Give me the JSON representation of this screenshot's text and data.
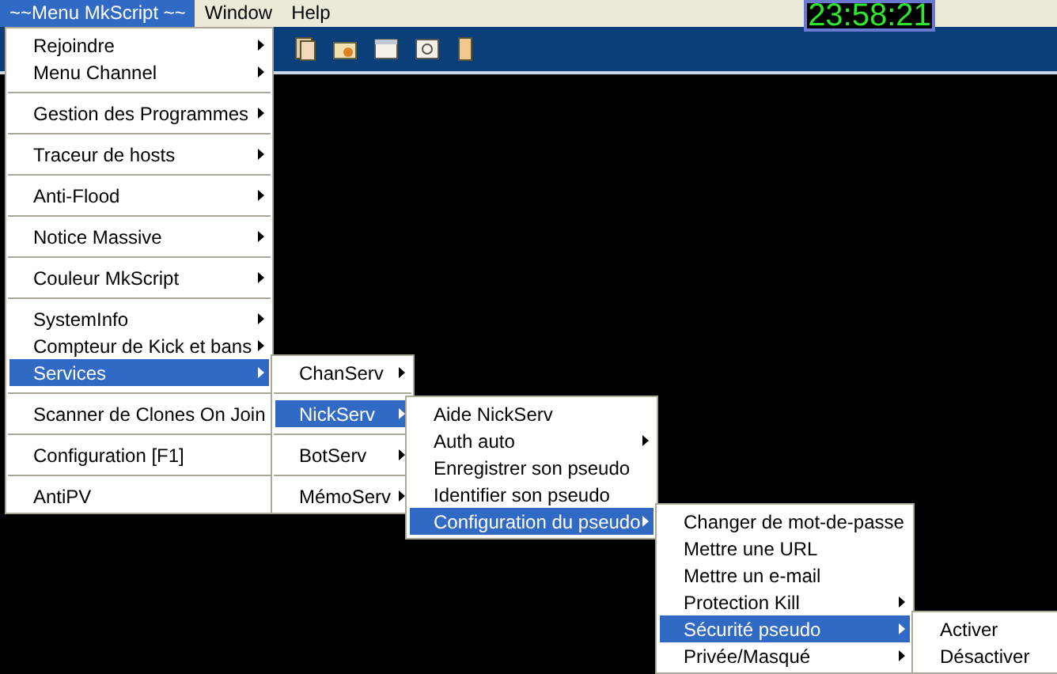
{
  "menubar": [
    {
      "label": "~~Menu MkScript ~~",
      "selected": true
    },
    {
      "label": "Window",
      "selected": false
    },
    {
      "label": "Help",
      "selected": false
    }
  ],
  "clock": "23:58:21",
  "menus": [
    {
      "items": [
        {
          "kind": "item",
          "label": "Rejoindre",
          "submenu": true,
          "selected": false
        },
        {
          "kind": "item",
          "label": "Menu Channel",
          "submenu": true,
          "selected": false
        },
        {
          "kind": "separator"
        },
        {
          "kind": "item",
          "label": "Gestion des Programmes",
          "submenu": true,
          "selected": false
        },
        {
          "kind": "separator"
        },
        {
          "kind": "item",
          "label": "Traceur de hosts",
          "submenu": true,
          "selected": false
        },
        {
          "kind": "separator"
        },
        {
          "kind": "item",
          "label": "Anti-Flood",
          "submenu": true,
          "selected": false
        },
        {
          "kind": "separator"
        },
        {
          "kind": "item",
          "label": "Notice Massive",
          "submenu": true,
          "selected": false
        },
        {
          "kind": "separator"
        },
        {
          "kind": "item",
          "label": "Couleur MkScript",
          "submenu": true,
          "selected": false
        },
        {
          "kind": "separator"
        },
        {
          "kind": "item",
          "label": "SystemInfo",
          "submenu": true,
          "selected": false
        },
        {
          "kind": "item",
          "label": "Compteur de Kick et bans",
          "submenu": true,
          "selected": false
        },
        {
          "kind": "item",
          "label": "Services",
          "submenu": true,
          "selected": true
        },
        {
          "kind": "separator"
        },
        {
          "kind": "item",
          "label": "Scanner de Clones On Join",
          "submenu": false,
          "selected": false
        },
        {
          "kind": "separator"
        },
        {
          "kind": "item",
          "label": "Configuration [F1]",
          "submenu": false,
          "selected": false
        },
        {
          "kind": "separator"
        },
        {
          "kind": "item",
          "label": "AntiPV",
          "submenu": false,
          "selected": false
        }
      ]
    },
    {
      "items": [
        {
          "kind": "item",
          "label": "ChanServ",
          "submenu": true,
          "selected": false
        },
        {
          "kind": "separator"
        },
        {
          "kind": "item",
          "label": "NickServ",
          "submenu": true,
          "selected": true
        },
        {
          "kind": "separator"
        },
        {
          "kind": "item",
          "label": "BotServ",
          "submenu": true,
          "selected": false
        },
        {
          "kind": "separator"
        },
        {
          "kind": "item",
          "label": "MémoServ",
          "submenu": true,
          "selected": false
        }
      ]
    },
    {
      "items": [
        {
          "kind": "item",
          "label": "Aide NickServ",
          "submenu": false,
          "selected": false
        },
        {
          "kind": "item",
          "label": "Auth auto",
          "submenu": true,
          "selected": false
        },
        {
          "kind": "item",
          "label": "Enregistrer son pseudo",
          "submenu": false,
          "selected": false
        },
        {
          "kind": "item",
          "label": "Identifier son pseudo",
          "submenu": false,
          "selected": false
        },
        {
          "kind": "item",
          "label": "Configuration du pseudo",
          "submenu": true,
          "selected": true
        }
      ]
    },
    {
      "items": [
        {
          "kind": "item",
          "label": "Changer de mot-de-passe",
          "submenu": false,
          "selected": false
        },
        {
          "kind": "item",
          "label": "Mettre une URL",
          "submenu": false,
          "selected": false
        },
        {
          "kind": "item",
          "label": "Mettre un e-mail",
          "submenu": false,
          "selected": false
        },
        {
          "kind": "item",
          "label": "Protection Kill",
          "submenu": true,
          "selected": false
        },
        {
          "kind": "item",
          "label": "Sécurité pseudo",
          "submenu": true,
          "selected": true
        },
        {
          "kind": "item",
          "label": "Privée/Masqué",
          "submenu": true,
          "selected": false
        }
      ]
    },
    {
      "items": [
        {
          "kind": "item",
          "label": "Activer",
          "submenu": false,
          "selected": false
        },
        {
          "kind": "item",
          "label": "Désactiver",
          "submenu": false,
          "selected": false
        }
      ]
    }
  ]
}
